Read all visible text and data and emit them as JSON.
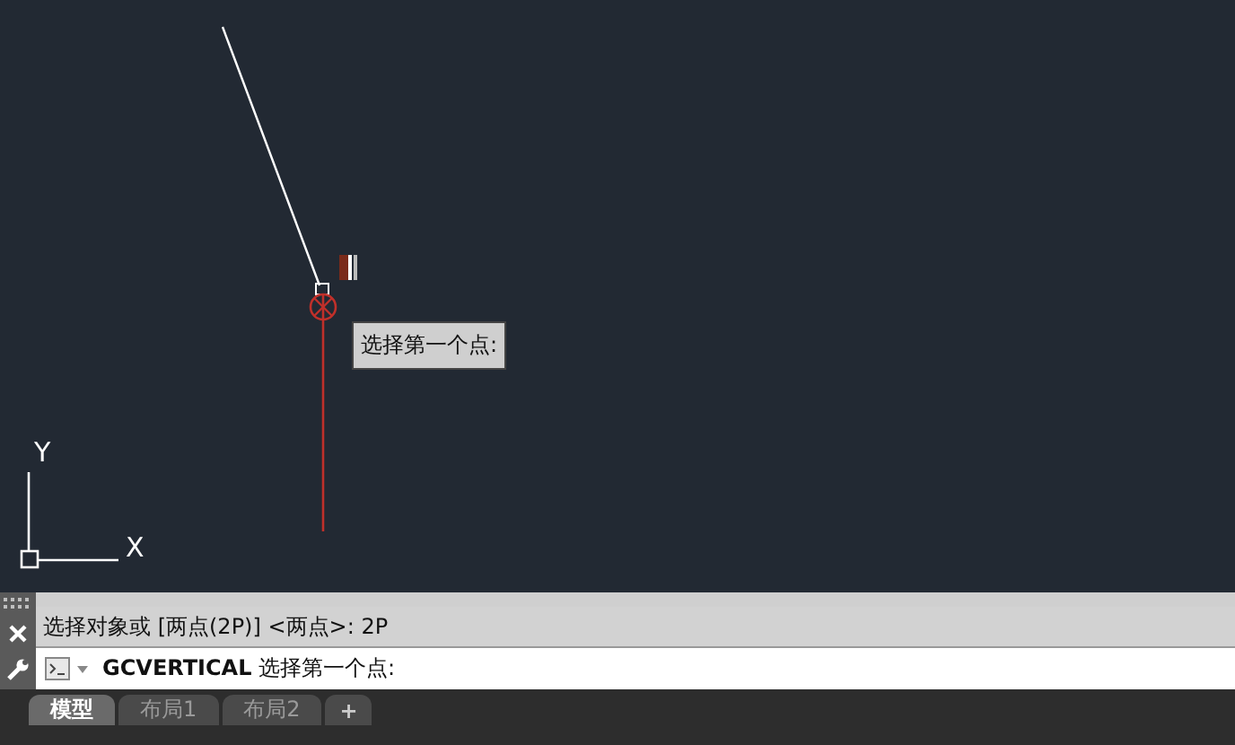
{
  "canvas": {
    "tooltip": "选择第一个点:",
    "ucs": {
      "x_label": "X",
      "y_label": "Y"
    }
  },
  "command_line": {
    "history": "选择对象或 [两点(2P)] <两点>: 2P",
    "input": "**GCVERTICAL** 选择第一个点:"
  },
  "layout_tabs": [
    {
      "label": "模型",
      "selected": true
    },
    {
      "label": "布局1",
      "selected": false
    },
    {
      "label": "布局2",
      "selected": false
    }
  ],
  "add_tab": "+"
}
